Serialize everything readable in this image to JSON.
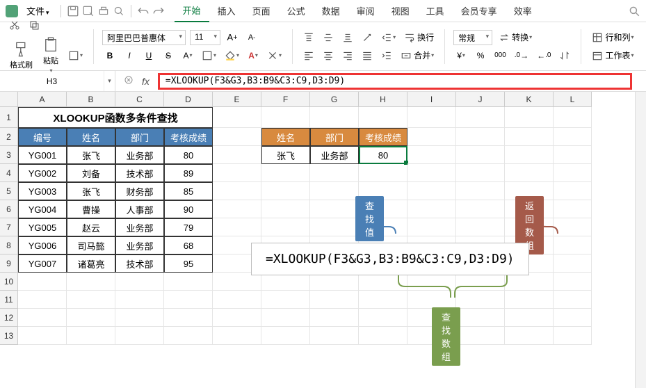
{
  "menubar": {
    "file": "文件",
    "tabs": [
      "开始",
      "插入",
      "页面",
      "公式",
      "数据",
      "审阅",
      "视图",
      "工具",
      "会员专享",
      "效率"
    ]
  },
  "ribbon": {
    "format_painter": "格式刷",
    "paste": "粘贴",
    "font_name": "阿里巴巴普惠体",
    "font_size": "11",
    "wrap": "换行",
    "merge": "合并",
    "num_format": "常规",
    "convert": "转换",
    "row_col": "行和列",
    "worksheet": "工作表"
  },
  "formula_bar": {
    "cell_ref": "H3",
    "formula": "=XLOOKUP(F3&G3,B3:B9&C3:C9,D3:D9)"
  },
  "columns": [
    "A",
    "B",
    "C",
    "D",
    "E",
    "F",
    "G",
    "H",
    "I",
    "J",
    "K",
    "L"
  ],
  "rows": [
    "1",
    "2",
    "3",
    "4",
    "5",
    "6",
    "7",
    "8",
    "9",
    "10",
    "11",
    "12",
    "13"
  ],
  "title": "XLOOKUP函数多条件查找",
  "headers_main": [
    "编号",
    "姓名",
    "部门",
    "考核成绩"
  ],
  "headers_lookup": [
    "姓名",
    "部门",
    "考核成绩"
  ],
  "data_main": [
    [
      "YG001",
      "张飞",
      "业务部",
      "80"
    ],
    [
      "YG002",
      "刘备",
      "技术部",
      "89"
    ],
    [
      "YG003",
      "张飞",
      "财务部",
      "85"
    ],
    [
      "YG004",
      "曹操",
      "人事部",
      "90"
    ],
    [
      "YG005",
      "赵云",
      "业务部",
      "79"
    ],
    [
      "YG006",
      "司马懿",
      "业务部",
      "68"
    ],
    [
      "YG007",
      "诸葛亮",
      "技术部",
      "95"
    ]
  ],
  "data_lookup": [
    "张飞",
    "业务部",
    "80"
  ],
  "diagram": {
    "tag_lookup_value": "查找值",
    "tag_return_array": "返回数组",
    "tag_lookup_array": "查找数组",
    "formula_display": "=XLOOKUP(F3&G3,B3:B9&C3:C9,D3:D9)"
  }
}
